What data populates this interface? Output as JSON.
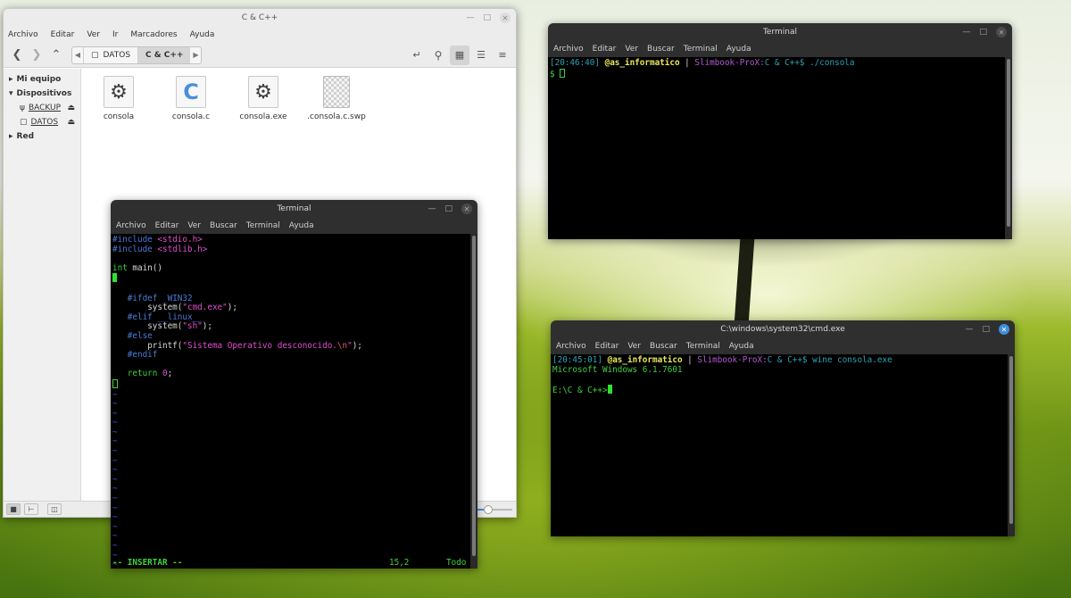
{
  "file_manager": {
    "title": "C & C++",
    "menu": [
      "Archivo",
      "Editar",
      "Ver",
      "Ir",
      "Marcadores",
      "Ayuda"
    ],
    "breadcrumb": [
      "DATOS",
      "C & C++"
    ],
    "sidebar": {
      "mi_equipo": "Mi equipo",
      "dispositivos": "Dispositivos",
      "devices": [
        "BACKUP",
        "DATOS"
      ],
      "red": "Red"
    },
    "files": [
      {
        "name": "consola",
        "icon": "gear-icon"
      },
      {
        "name": "consola.c",
        "icon": "c-source-icon"
      },
      {
        "name": "consola.exe",
        "icon": "gear-icon"
      },
      {
        "name": ".consola.c.swp",
        "icon": "checker-file-icon"
      }
    ]
  },
  "terminal_top": {
    "title": "Terminal",
    "menu": [
      "Archivo",
      "Editar",
      "Ver",
      "Buscar",
      "Terminal",
      "Ayuda"
    ],
    "prompt_time": "[20:46:40]",
    "prompt_user": "@as_informatico",
    "prompt_sep": " | ",
    "prompt_host": "Slimbook-ProX:",
    "prompt_path": "C & C++",
    "prompt_cmd": "$ ./consola",
    "second_line": "$ "
  },
  "terminal_vim": {
    "title": "Terminal",
    "menu": [
      "Archivo",
      "Editar",
      "Ver",
      "Buscar",
      "Terminal",
      "Ayuda"
    ],
    "status_mode": "-- INSERTAR --",
    "status_pos": "15,2",
    "status_scroll": "Todo"
  },
  "terminal_cmd": {
    "title": "C:\\windows\\system32\\cmd.exe",
    "menu": [
      "Archivo",
      "Editar",
      "Ver",
      "Buscar",
      "Terminal",
      "Ayuda"
    ],
    "prompt_time": "[20:45:01]",
    "prompt_user": "@as_informatico",
    "prompt_sep": " | ",
    "prompt_host": "Slimbook-ProX:",
    "prompt_path": "C & C++",
    "prompt_cmd": "$ wine consola.exe",
    "output_line": "Microsoft Windows 6.1.7601",
    "dos_prompt": "E:\\C & C++>"
  },
  "colors": {
    "terminal_bg": "#000000",
    "prompt_green": "#3fd13f",
    "prompt_cyan": "#2aa1b3",
    "prompt_yellow": "#e8e85a",
    "prompt_purple": "#b35ad1",
    "accent_blue": "#3d8fd9"
  }
}
